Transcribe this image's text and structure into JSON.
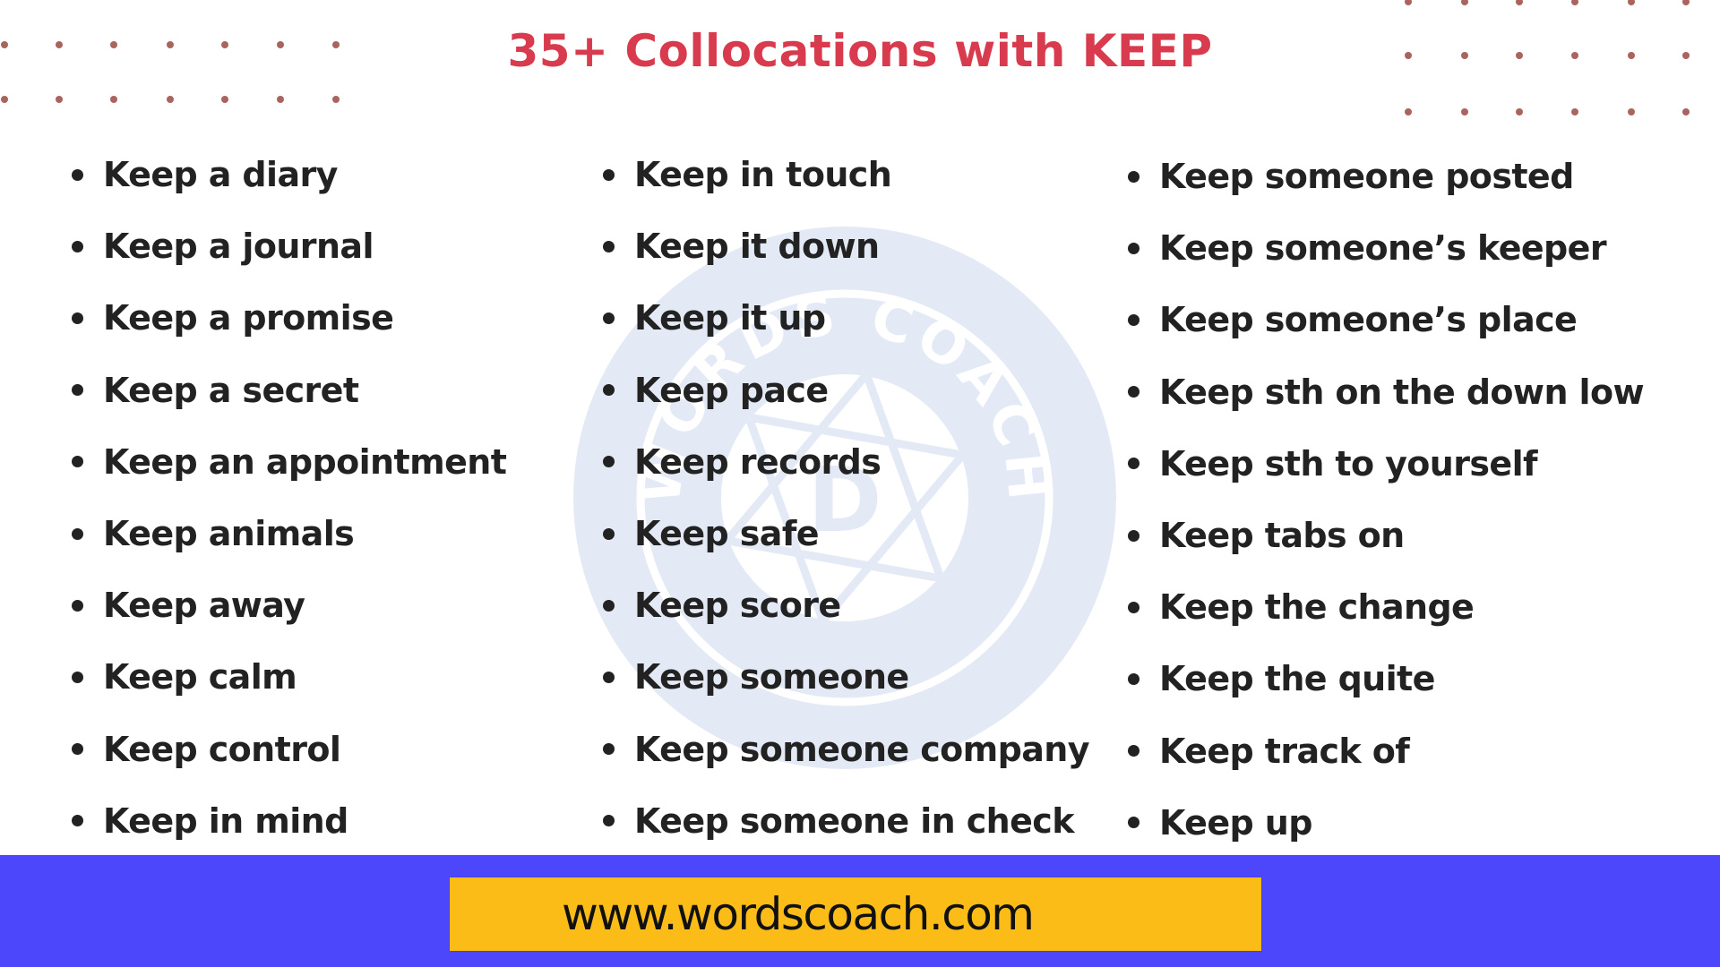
{
  "title": "35+ Collocations with KEEP",
  "colors": {
    "title": "#d93b4e",
    "text": "#222222",
    "dots": "#a8645d",
    "watermark": "#e4eaf5",
    "footer_bg": "#4c47fb",
    "url_box_bg": "#fbbc17"
  },
  "columns": [
    {
      "items": [
        "Keep a diary",
        "Keep a journal",
        "Keep a promise",
        "Keep a secret",
        "Keep an appointment",
        "Keep animals",
        "Keep away",
        "Keep calm",
        "Keep control",
        "Keep in mind"
      ]
    },
    {
      "items": [
        "Keep in touch",
        "Keep it down",
        "Keep it up",
        "Keep pace",
        "Keep records",
        "Keep safe",
        "Keep score",
        "Keep someone",
        "Keep someone company",
        "Keep someone in check"
      ]
    },
    {
      "items": [
        "Keep someone posted",
        "Keep someone’s keeper",
        "Keep someone’s place",
        "Keep sth on the down low",
        "Keep sth to yourself",
        "Keep tabs on",
        "Keep the change",
        "Keep the quite",
        "Keep track of",
        "Keep up"
      ]
    }
  ],
  "watermark": {
    "icon": "aperture-logo-icon",
    "arc_text": "WORDS COACH",
    "center_letter": "D"
  },
  "footer": {
    "url": "www.wordscoach.com"
  }
}
